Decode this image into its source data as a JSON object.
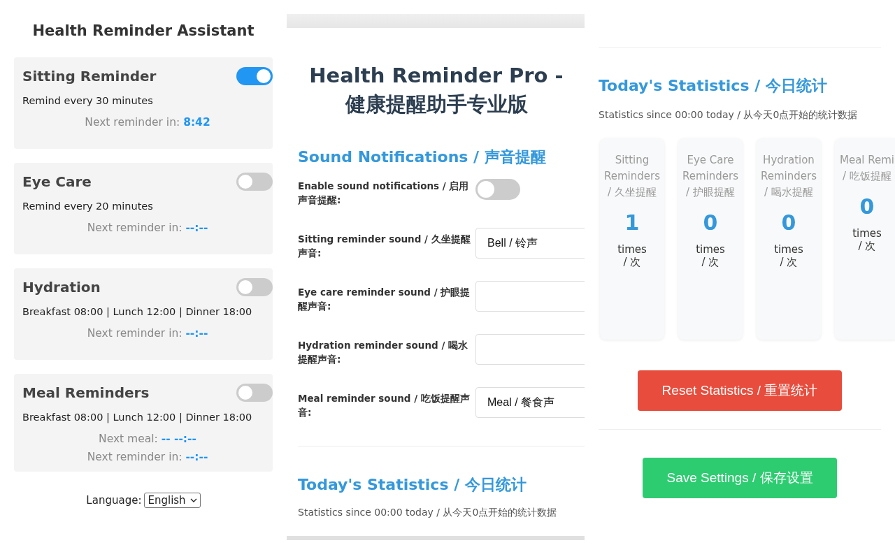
{
  "left": {
    "title": "Health Reminder Assistant",
    "reminders": [
      {
        "name": "Sitting Reminder",
        "enabled": true,
        "description": "Remind every 30 minutes",
        "lines": [
          {
            "label": "Next reminder in:",
            "value": "8:42"
          }
        ]
      },
      {
        "name": "Eye Care",
        "enabled": false,
        "description": "Remind every 20 minutes",
        "lines": [
          {
            "label": "Next reminder in:",
            "value": "--:--"
          }
        ]
      },
      {
        "name": "Hydration",
        "enabled": false,
        "description": "Breakfast 08:00 | Lunch 12:00 | Dinner 18:00",
        "lines": [
          {
            "label": "Next reminder in:",
            "value": "--:--"
          }
        ]
      },
      {
        "name": "Meal Reminders",
        "enabled": false,
        "description": "Breakfast 08:00 | Lunch 12:00 | Dinner 18:00",
        "lines": [
          {
            "label": "Next meal:",
            "value": "-- --:--"
          },
          {
            "label": "Next reminder in:",
            "value": "--:--"
          }
        ]
      }
    ],
    "language": {
      "label": "Language:",
      "value": "English"
    }
  },
  "middle": {
    "title": "Health Reminder Pro - 健康提醒助手专业版",
    "sound_section": {
      "heading": "Sound Notifications / 声音提醒",
      "enable": {
        "label": "Enable sound notifications / 启用声音提醒:",
        "on": false
      },
      "sounds": [
        {
          "label": "Sitting reminder sound / 久坐提醒声音:",
          "value": "Bell / 铃声"
        },
        {
          "label": "Eye care reminder sound / 护眼提醒声音:"
        },
        {
          "label": "Hydration reminder sound / 喝水提醒声音:"
        },
        {
          "label": "Meal reminder sound / 吃饭提醒声音:",
          "value": "Meal / 餐食声"
        }
      ]
    },
    "stats_section": {
      "heading": "Today's Statistics / 今日统计",
      "subtitle": "Statistics since 00:00 today / 从今天0点开始的统计数据"
    }
  },
  "right": {
    "stats": {
      "heading": "Today's Statistics / 今日统计",
      "subtitle": "Statistics since 00:00 today / 从今天0点开始的统计数据",
      "cards": [
        {
          "label": "Sitting Reminders / 久坐提醒",
          "count": "1",
          "unit": "times / 次"
        },
        {
          "label": "Eye Care Reminders / 护眼提醒",
          "count": "0",
          "unit": "times / 次"
        },
        {
          "label": "Hydration Reminders / 喝水提醒",
          "count": "0",
          "unit": "times / 次"
        },
        {
          "label": "Meal Remi / 吃饭提醒",
          "count": "0",
          "unit": "times / 次"
        }
      ]
    },
    "reset_button": "Reset Statistics / 重置统计",
    "save_button": "Save Settings / 保存设置"
  }
}
